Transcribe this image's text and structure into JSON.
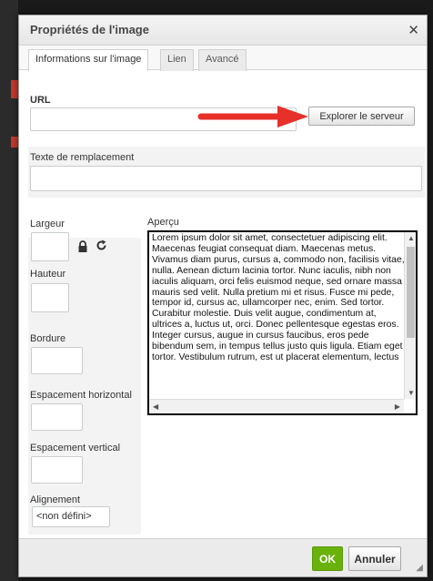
{
  "dialog": {
    "title": "Propriétés de l'image",
    "close_glyph": "✕"
  },
  "tabs": [
    {
      "label": "Informations sur l'image",
      "active": true
    },
    {
      "label": "Lien",
      "active": false
    },
    {
      "label": "Avancé",
      "active": false
    }
  ],
  "url": {
    "label": "URL",
    "value": "",
    "browse_button": "Explorer le serveur"
  },
  "alt_text": {
    "label": "Texte de remplacement",
    "value": ""
  },
  "dimensions": {
    "width_label": "Largeur",
    "height_label": "Hauteur",
    "border_label": "Bordure",
    "hspace_label": "Espacement horizontal",
    "vspace_label": "Espacement vertical",
    "align_label": "Alignement",
    "align_value": "<non défini>"
  },
  "preview": {
    "label": "Aperçu",
    "text": "Lorem ipsum dolor sit amet, consectetuer adipiscing elit. Maecenas feugiat consequat diam. Maecenas metus. Vivamus diam purus, cursus a, commodo non, facilisis vitae, nulla. Aenean dictum lacinia tortor. Nunc iaculis, nibh non iaculis aliquam, orci felis euismod neque, sed ornare massa mauris sed velit. Nulla pretium mi et risus. Fusce mi pede, tempor id, cursus ac, ullamcorper nec, enim. Sed tortor. Curabitur molestie. Duis velit augue, condimentum at, ultrices a, luctus ut, orci. Donec pellentesque egestas eros. Integer cursus, augue in cursus faucibus, eros pede bibendum sem, in tempus tellus justo quis ligula. Etiam eget tortor. Vestibulum rutrum, est ut placerat elementum, lectus"
  },
  "footer": {
    "ok_label": "OK",
    "cancel_label": "Annuler"
  },
  "colors": {
    "ok_green": "#69b10b",
    "annotation_arrow": "#e8302b"
  }
}
